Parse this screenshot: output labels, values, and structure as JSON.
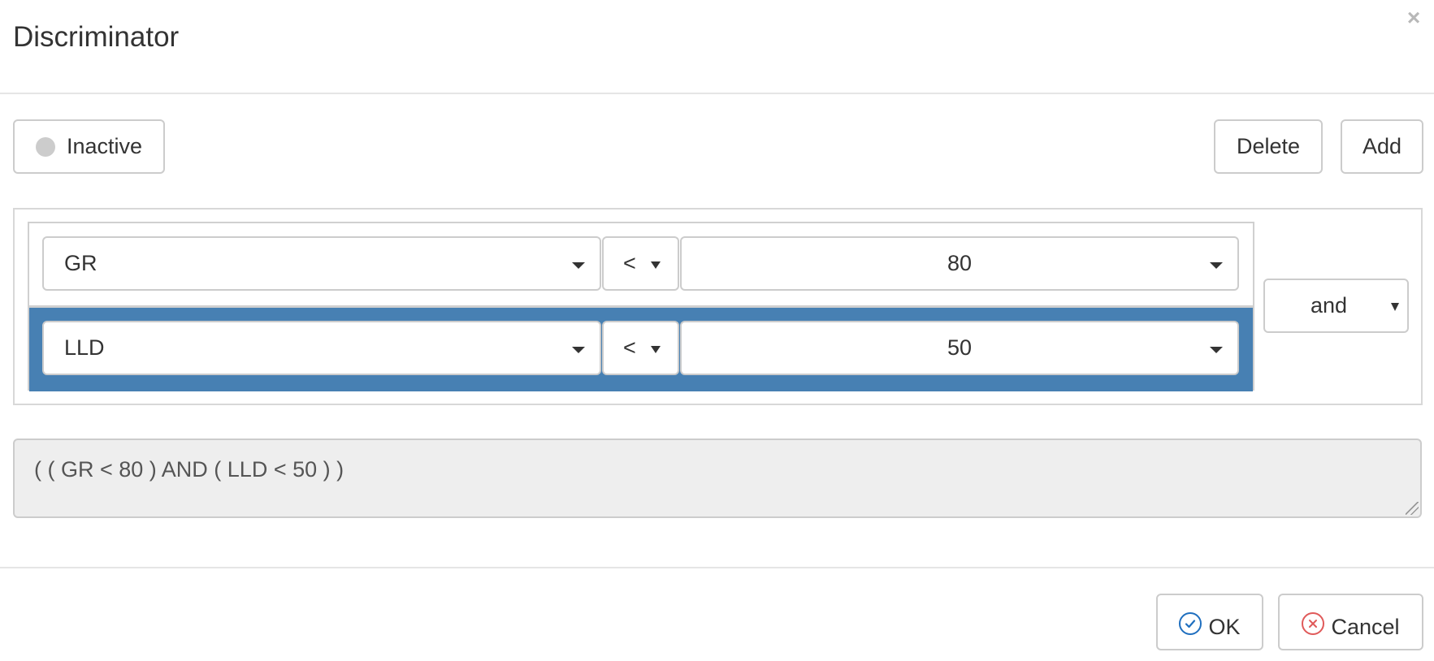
{
  "dialog": {
    "title": "Discriminator",
    "close_glyph": "×"
  },
  "toolbar": {
    "status_label": "Inactive",
    "delete_label": "Delete",
    "add_label": "Add"
  },
  "rules": [
    {
      "field": "GR",
      "operator": "<",
      "value": "80",
      "selected": false
    },
    {
      "field": "LLD",
      "operator": "<",
      "value": "50",
      "selected": true
    }
  ],
  "logic": {
    "combinator": "and"
  },
  "expression": {
    "text": "( ( GR < 80 ) AND ( LLD < 50 ) )"
  },
  "footer": {
    "ok_label": "OK",
    "cancel_label": "Cancel"
  },
  "colors": {
    "selected_row": "#4780b3",
    "ok_icon": "#1f6fbf",
    "cancel_icon": "#e05a5a",
    "inactive_dot": "#cccccc"
  },
  "icons": {
    "close": "close-icon",
    "status": "status-dot-icon",
    "dropdown": "caret-down-icon",
    "ok": "check-circle-icon",
    "cancel": "x-circle-icon"
  }
}
